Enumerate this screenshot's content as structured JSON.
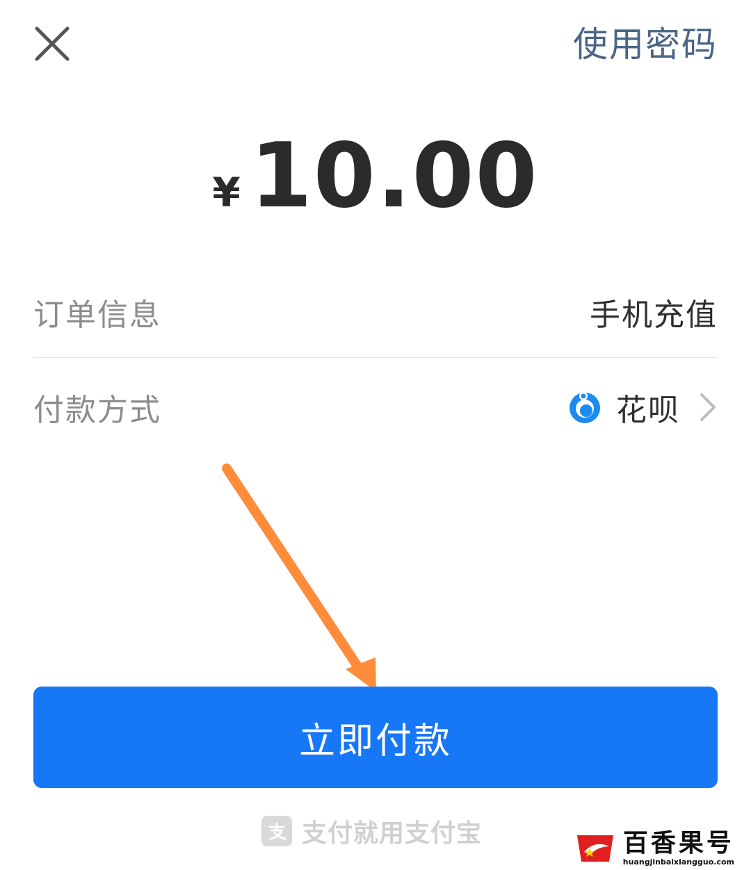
{
  "header": {
    "close_icon": "close-icon",
    "use_password_label": "使用密码"
  },
  "amount": {
    "currency_symbol": "¥",
    "value": "10.00"
  },
  "order_info": {
    "label": "订单信息",
    "value": "手机充值"
  },
  "payment_method": {
    "label": "付款方式",
    "value": "花呗",
    "icon": "huabei-icon",
    "chevron_icon": "chevron-right-icon"
  },
  "pay_button": {
    "label": "立即付款",
    "color": "#1778f7"
  },
  "annotation": {
    "arrow_color": "#ff8c3a"
  },
  "footer": {
    "logo_icon": "alipay-logo-icon",
    "slogan": "支付就用支付宝"
  },
  "watermark": {
    "title": "百香果号",
    "url": "huangjinbaixiangguo.com"
  }
}
